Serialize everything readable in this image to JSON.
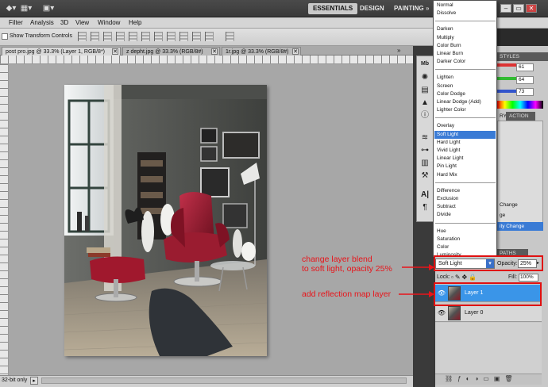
{
  "appbar": {
    "workspaces": [
      "ESSENTIALS",
      "DESIGN",
      "PAINTING"
    ],
    "more": "»"
  },
  "menus": [
    "Filter",
    "Analysis",
    "3D",
    "View",
    "Window",
    "Help"
  ],
  "options": {
    "show_transform_controls": "Show Transform Controls"
  },
  "tabs": [
    {
      "label": "post pro.jpg @ 33.3% (Layer 1, RGB/8*)"
    },
    {
      "label": "z depht.jpg @ 33.3% (RGB/8#)"
    },
    {
      "label": "1r.jpg @ 33.3% (RGB/8#)"
    }
  ],
  "status": {
    "text": "32-bit only"
  },
  "blend_modes": {
    "groups": [
      [
        "Normal",
        "Dissolve"
      ],
      [
        "Darken",
        "Multiply",
        "Color Burn",
        "Linear Burn",
        "Darker Color"
      ],
      [
        "Lighten",
        "Screen",
        "Color Dodge",
        "Linear Dodge (Add)",
        "Lighter Color"
      ],
      [
        "Overlay",
        "Soft Light",
        "Hard Light",
        "Vivid Light",
        "Linear Light",
        "Pin Light",
        "Hard Mix"
      ],
      [
        "Difference",
        "Exclusion",
        "Subtract",
        "Divide"
      ],
      [
        "Hue",
        "Saturation",
        "Color",
        "Luminosity"
      ]
    ],
    "selected": "Soft Light"
  },
  "panels": {
    "styles_tab": "STYLES",
    "color_values": [
      "61",
      "64",
      "73"
    ],
    "history_tab": "RY",
    "actions_tab": "ACTION",
    "history_items": [
      "Change",
      "ge",
      "ity Change"
    ],
    "paths_tab": "PATHS"
  },
  "layers": {
    "blend_mode": "Soft Light",
    "opacity_label": "Opacity:",
    "opacity": "25%",
    "lock_label": "Lock:",
    "fill_label": "Fill:",
    "fill": "100%",
    "items": [
      {
        "name": "Layer 1",
        "selected": true
      },
      {
        "name": "Layer 0",
        "selected": false
      }
    ]
  },
  "annotations": {
    "blend_note_line1": "change layer blend",
    "blend_note_line2": "to soft light, opacity 25%",
    "reflection_note": "add reflection map layer"
  },
  "colors": {
    "annotation_red": "#e8141a",
    "selection_blue": "#3a95e8",
    "chair_red": "#8e1425"
  }
}
